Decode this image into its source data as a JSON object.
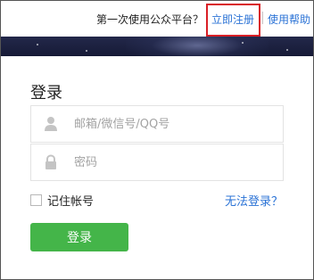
{
  "header": {
    "first_use_text": "第一次使用公众平台？",
    "register_label": "立即注册",
    "help_label": "使用帮助"
  },
  "login": {
    "title": "登录",
    "account_placeholder": "邮箱/微信号/QQ号",
    "password_placeholder": "密码",
    "remember_label": "记住帐号",
    "forgot_label": "无法登录？",
    "submit_label": "登录"
  },
  "colors": {
    "link": "#2b73d6",
    "highlight_box": "#d91f26",
    "button": "#44b549",
    "banner": "#1c2040"
  },
  "icons": {
    "account": "user-icon",
    "password": "lock-icon"
  }
}
